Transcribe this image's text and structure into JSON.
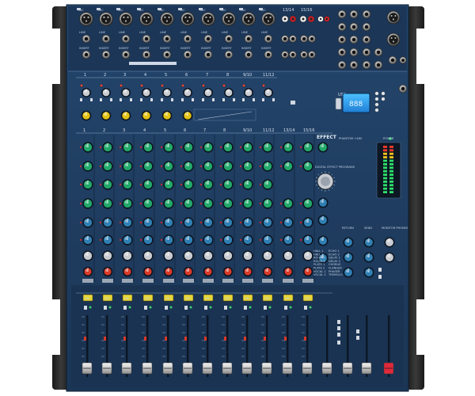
{
  "mixer": {
    "channel_numbers": [
      "1",
      "2",
      "3",
      "4",
      "5",
      "6",
      "7",
      "8",
      "9/10",
      "11/12"
    ],
    "strip_numbers": [
      "1",
      "2",
      "3",
      "4",
      "5",
      "6",
      "7",
      "8",
      "9/10",
      "11/12",
      "13/14",
      "15/16"
    ],
    "stereo_numbers": [
      "13/14",
      "15/16"
    ],
    "sections": {
      "effect": "EFFECT",
      "usb_label": "USB",
      "display_text": "888",
      "digital_effect": "DIGITAL EFFECT PROGRAMS",
      "phantom": "PHANTOM +48V",
      "power": "POWER",
      "return": "RETURN",
      "send": "SEND",
      "monitor": "MONITOR PHONES",
      "on_label": "ON",
      "mic": "MIC",
      "line": "LINE",
      "insert": "INSERT",
      "aux": "AUX",
      "pfl": "PFL"
    },
    "effect_programs": [
      "HALL 1",
      "HALL 2",
      "ROOM 1",
      "ROOM 2",
      "PLATE 1",
      "PLATE 2",
      "VOCAL 1",
      "VOCAL 2",
      "ECHO 1",
      "ECHO 2",
      "DELAY 1",
      "DELAY 2",
      "CHORUS",
      "FLANGER",
      "PHASER",
      "TREMOLO"
    ],
    "colors": {
      "panel": "#1e3a5c",
      "frame": "#2b2b2b",
      "knob_green": "#22a86a",
      "knob_blue": "#2f7fb3",
      "knob_yellow": "#e3c315",
      "knob_red": "#d83a2a",
      "on_button": "#e7d63a",
      "meter_green": "#2ee06a",
      "meter_red": "#ff3a2a",
      "lcd": "#2fa8ff"
    }
  }
}
